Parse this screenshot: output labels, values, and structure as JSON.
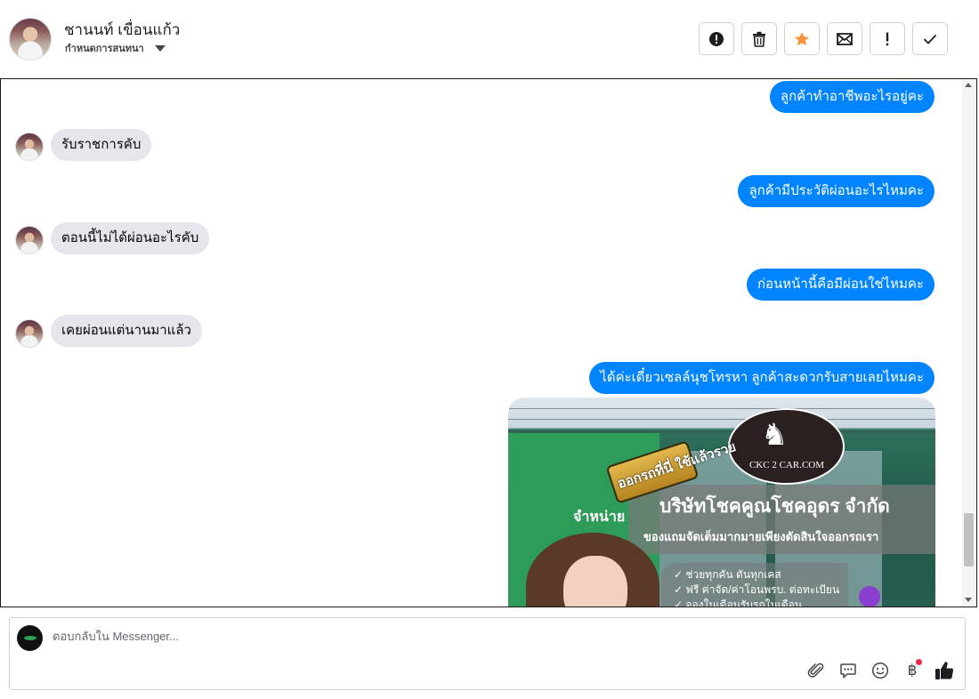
{
  "header": {
    "contact_name": "ชานนท์ เขื่อนแก้ว",
    "conversation_status": "กำหนดการสนทนา",
    "actions": [
      {
        "name": "mark-spam-button",
        "icon": "alert-circle-icon"
      },
      {
        "name": "delete-button",
        "icon": "trash-icon"
      },
      {
        "name": "star-button",
        "icon": "star-icon",
        "color": "#f7923a"
      },
      {
        "name": "mark-unread-button",
        "icon": "envelope-icon"
      },
      {
        "name": "follow-up-button",
        "icon": "exclamation-icon"
      },
      {
        "name": "mark-done-button",
        "icon": "check-icon"
      }
    ]
  },
  "messages": [
    {
      "from": "page",
      "text": "ลูกค้าทำอาชีพอะไรอยู่คะ"
    },
    {
      "from": "customer",
      "text": "รับราชการคับ"
    },
    {
      "from": "page",
      "text": "ลูกค้ามีประวัติผ่อนอะไรไหมคะ"
    },
    {
      "from": "customer",
      "text": "ตอนนี้ไม่ได้ผ่อนอะไรคับ"
    },
    {
      "from": "page",
      "text": "ก่อนหน้านี้คือมีผ่อนใช่ไหมคะ"
    },
    {
      "from": "customer",
      "text": "เคยผ่อนแต่นานมาแล้ว"
    },
    {
      "from": "page",
      "text": "ได้ค่ะเดี๋ยวเซลล์นุชโทรหา ลูกค้าสะดวกรับสายเลยไหมคะ"
    }
  ],
  "attachment": {
    "logo_text": "CKC 2 CAR.COM",
    "badge_text": "ออกรถที่นี่ ใช้แล้วรวย",
    "company_name": "บริษัทโชคคูณโชคอุดร จำกัด",
    "tagline": "ของแถมจัดเต็มมากมายเพียงตัดสินใจออกรถเรา",
    "sign_text": "จำหน่าย",
    "bullets": [
      "✓ ช่วยทุกคัน ดันทุกเคส",
      "✓ ฟรี ค่าจัด/ค่าโอนพรบ. ต่อทะเบียน",
      "✓ จองในเดือนรับรถในเดือน"
    ]
  },
  "composer": {
    "placeholder": "ตอบกลับใน Messenger...",
    "tools": [
      "paperclip-icon",
      "message-bubble-icon",
      "smiley-icon",
      "baht-icon",
      "thumbs-up-icon"
    ],
    "baht_symbol": "฿"
  },
  "colors": {
    "outgoing_bubble": "#0084ff",
    "incoming_bubble": "#e4e6eb",
    "star": "#f7923a",
    "notification_dot": "#f02849"
  }
}
